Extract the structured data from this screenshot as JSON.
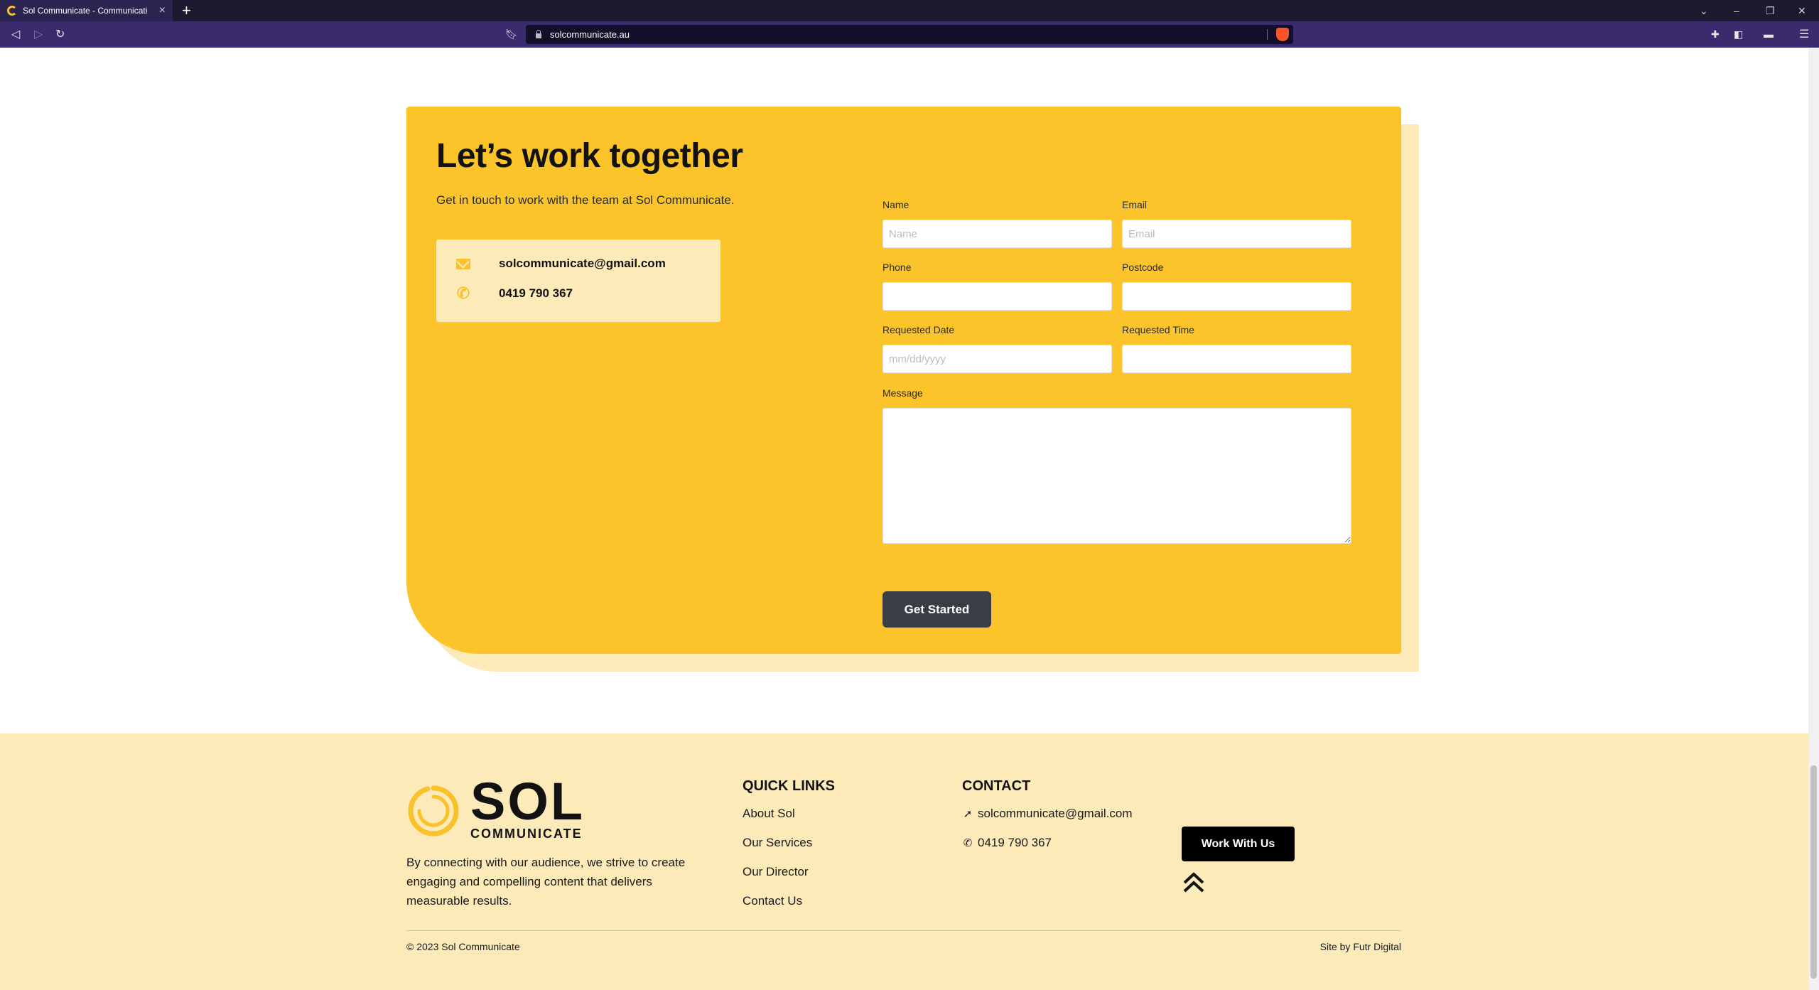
{
  "browser": {
    "tab_title": "Sol Communicate - Communicati",
    "url": "solcommunicate.au",
    "new_tab_symbol": "+",
    "tab_close_symbol": "×"
  },
  "contact_section": {
    "title": "Let’s work together",
    "subtitle": "Get in touch to work with the team at Sol Communicate.",
    "email": "solcommunicate@gmail.com",
    "phone": "0419 790 367",
    "form": {
      "name_label": "Name",
      "name_placeholder": "Name",
      "email_label": "Email",
      "email_placeholder": "Email",
      "phone_label": "Phone",
      "postcode_label": "Postcode",
      "date_label": "Requested Date",
      "date_placeholder": "mm/dd/yyyy",
      "time_label": "Requested Time",
      "message_label": "Message",
      "submit_label": "Get Started"
    }
  },
  "footer": {
    "logo_main": "SOL",
    "logo_sub": "COMMUNICATE",
    "description": "By connecting with our audience, we strive to create engaging and compelling content that delivers measurable results.",
    "quick_links_heading": "QUICK LINKS",
    "quick_links": [
      "About Sol",
      "Our Services",
      "Our Director",
      "Contact Us"
    ],
    "contact_heading": "CONTACT",
    "contact_email": "solcommunicate@gmail.com",
    "contact_phone": "0419 790 367",
    "cta_label": "Work With Us",
    "copyright": "© 2023 Sol Communicate",
    "credit": "Site by Futr Digital"
  },
  "colors": {
    "brand_yellow": "#fbc42a",
    "pale_yellow": "#fdeab9",
    "dark_button": "#3a3d45",
    "browser_toolbar": "#3a2a6e"
  }
}
